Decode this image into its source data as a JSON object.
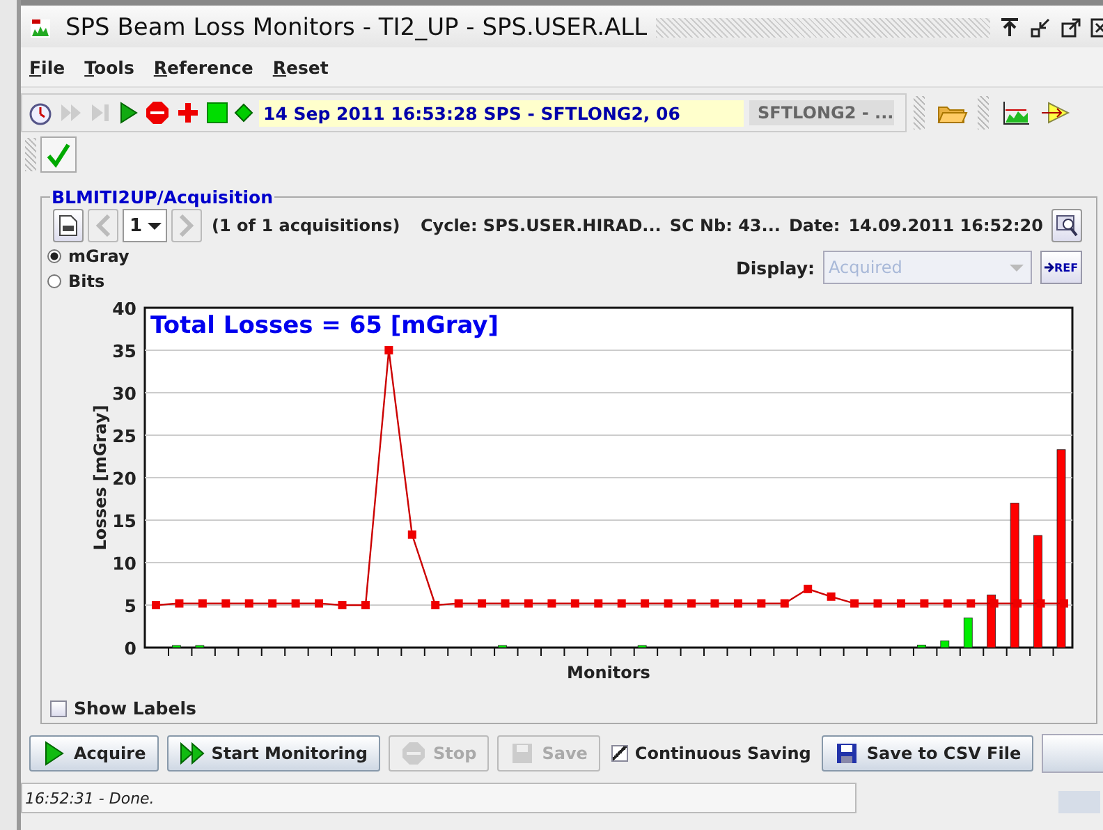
{
  "window": {
    "title": "SPS Beam Loss Monitors - TI2_UP - SPS.USER.ALL"
  },
  "menu": [
    {
      "label": "File"
    },
    {
      "label": "Tools"
    },
    {
      "label": "Reference"
    },
    {
      "label": "Reset"
    }
  ],
  "toolbar": {
    "info": "14 Sep 2011  16:53:28  SPS - SFTLONG2, 06",
    "selector": "SFTLONG2 - ..."
  },
  "panel": {
    "title": "BLMITI2UP/Acquisition",
    "page": "1",
    "acquisitions": "(1 of 1 acquisitions)",
    "cycle": "Cycle: SPS.USER.HIRAD...",
    "sc": "SC Nb: 43...",
    "date_label": "Date:",
    "date": "14.09.2011 16:52:20",
    "units": [
      {
        "label": "mGray",
        "selected": true
      },
      {
        "label": "Bits",
        "selected": false
      }
    ],
    "display_label": "Display:",
    "display": {
      "value": "Acquired",
      "disabled": true
    },
    "ref_button": "REF",
    "chart_data": {
      "type": "bar",
      "title": "Total Losses = 65 [mGray]",
      "xlabel": "Monitors",
      "ylabel": "Losses [mGray]",
      "ylim": [
        0,
        40
      ],
      "yticks": [
        0,
        5,
        10,
        15,
        20,
        25,
        30,
        35,
        40
      ],
      "grid": true,
      "series": [
        {
          "color": "#00ee00",
          "values": [
            0,
            0.1,
            0.1,
            0,
            0,
            0,
            0,
            0,
            0,
            0,
            0,
            0,
            0,
            0,
            0,
            0.1,
            0,
            0,
            0,
            0,
            0,
            0.1,
            0,
            0,
            0,
            0,
            0,
            0,
            0,
            0,
            0,
            0,
            0,
            0.3,
            0.8,
            3.5,
            null,
            null,
            null,
            null
          ]
        },
        {
          "color": "#ff0000",
          "values": [
            null,
            null,
            null,
            null,
            null,
            null,
            null,
            null,
            null,
            null,
            null,
            null,
            null,
            null,
            null,
            null,
            null,
            null,
            null,
            null,
            null,
            null,
            null,
            null,
            null,
            null,
            null,
            null,
            null,
            null,
            null,
            null,
            null,
            null,
            null,
            null,
            6.2,
            17,
            13.2,
            23.3
          ]
        },
        {
          "color": "#cc0000",
          "type": "line",
          "marker": "square",
          "values": [
            5,
            5.2,
            5.2,
            5.2,
            5.2,
            5.2,
            5.2,
            5.2,
            5,
            5,
            35,
            13.3,
            5,
            5.2,
            5.2,
            5.2,
            5.2,
            5.2,
            5.2,
            5.2,
            5.2,
            5.2,
            5.2,
            5.2,
            5.2,
            5.2,
            5.2,
            5.2,
            6.9,
            6,
            5.2,
            5.2,
            5.2,
            5.2,
            5.2,
            5.2,
            5.2,
            5.2,
            5.2,
            5.2
          ]
        }
      ]
    },
    "show_labels": {
      "label": "Show Labels",
      "checked": false
    }
  },
  "buttons": [
    {
      "label": "Acquire",
      "kind": "play",
      "disabled": false
    },
    {
      "label": "Start Monitoring",
      "kind": "fast",
      "disabled": false
    },
    {
      "label": "Stop",
      "kind": "stop",
      "disabled": true
    },
    {
      "label": "Save",
      "kind": "save",
      "disabled": true
    },
    {
      "label": "Continuous Saving",
      "kind": "checkbox",
      "checked": true
    },
    {
      "label": "Save to CSV File",
      "kind": "csv",
      "disabled": false
    }
  ],
  "status_bar": {
    "text": "16:52:31 - Done."
  }
}
